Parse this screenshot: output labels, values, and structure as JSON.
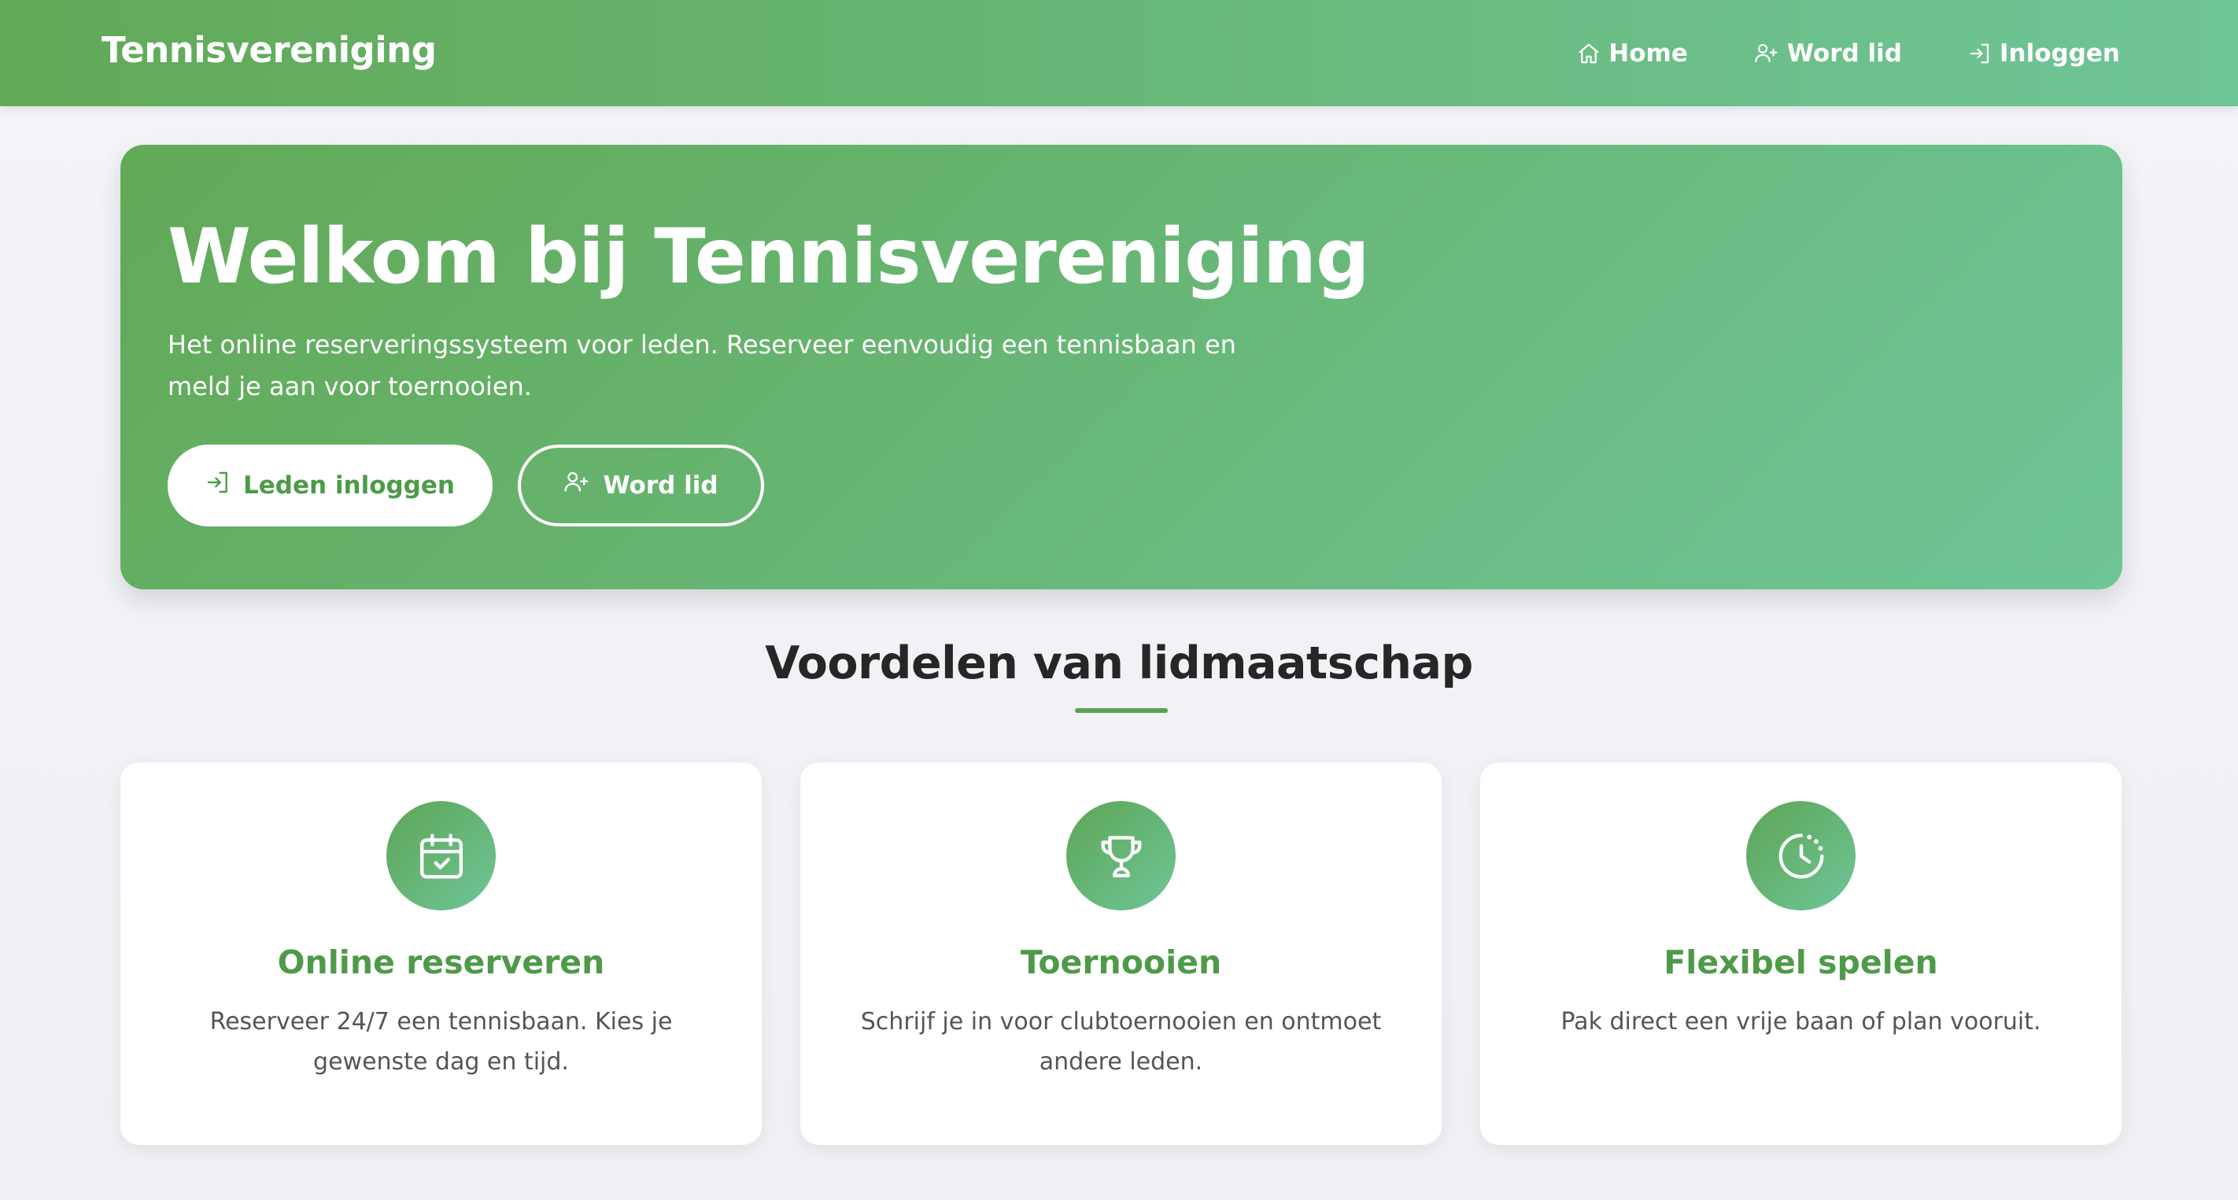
{
  "colors": {
    "brand_start": "#62a957",
    "brand_end": "#6ec597",
    "accent_text": "#4e9a48"
  },
  "navbar": {
    "brand": "Tennisvereniging",
    "links": [
      {
        "label": "Home",
        "icon": "home-icon"
      },
      {
        "label": "Word lid",
        "icon": "user-plus-icon"
      },
      {
        "label": "Inloggen",
        "icon": "login-icon"
      }
    ]
  },
  "hero": {
    "title": "Welkom bij Tennisvereniging",
    "subtitle": "Het online reserveringssysteem voor leden. Reserveer eenvoudig een tennisbaan en meld je aan voor toernooien.",
    "primary_button": {
      "label": "Leden inloggen",
      "icon": "login-icon"
    },
    "secondary_button": {
      "label": "Word lid",
      "icon": "user-plus-icon"
    }
  },
  "benefits": {
    "title": "Voordelen van lidmaatschap",
    "cards": [
      {
        "title": "Online reserveren",
        "text": "Reserveer 24/7 een tennisbaan. Kies je gewenste dag en tijd.",
        "icon": "calendar-check-icon"
      },
      {
        "title": "Toernooien",
        "text": "Schrijf je in voor clubtoernooien en ontmoet andere leden.",
        "icon": "trophy-icon"
      },
      {
        "title": "Flexibel spelen",
        "text": "Pak direct een vrije baan of plan vooruit.",
        "icon": "clock-icon"
      }
    ]
  }
}
